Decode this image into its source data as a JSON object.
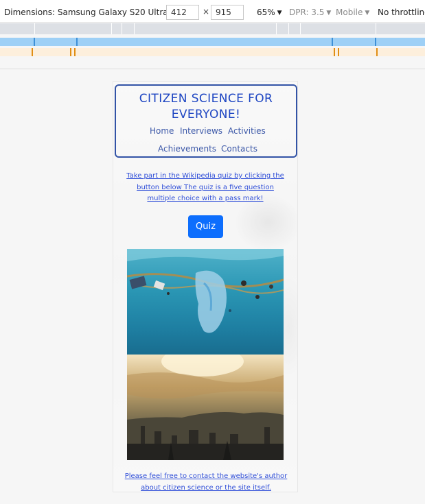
{
  "devtools": {
    "device_label": "Dimensions: Samsung Galaxy S20 Ultra",
    "width": "412",
    "times_sign": "×",
    "height": "915",
    "zoom": "65%",
    "dpr": "DPR: 3.5",
    "mode": "Mobile",
    "throttling": "No throttling"
  },
  "site": {
    "title": "CITIZEN SCIENCE FOR EVERYONE!",
    "nav": [
      "Home",
      "Interviews",
      "Activities",
      "Achievements",
      "Contacts"
    ],
    "intro_link": "Take part in the Wikipedia quiz by clicking the button below The quiz is a five question multiple choice with a pass mark!",
    "quiz_button": "Quiz",
    "images": [
      "plastic-pollution-underwater-image",
      "city-sunset-skyline-image"
    ],
    "contact_link": "Please feel free to contact the website's author about citizen science or the site itself."
  },
  "colors": {
    "title": "#1d45c2",
    "nav": "#3c58a8",
    "link": "#2f4ed8",
    "button": "#0d6efd",
    "header_border": "#3253a6"
  }
}
